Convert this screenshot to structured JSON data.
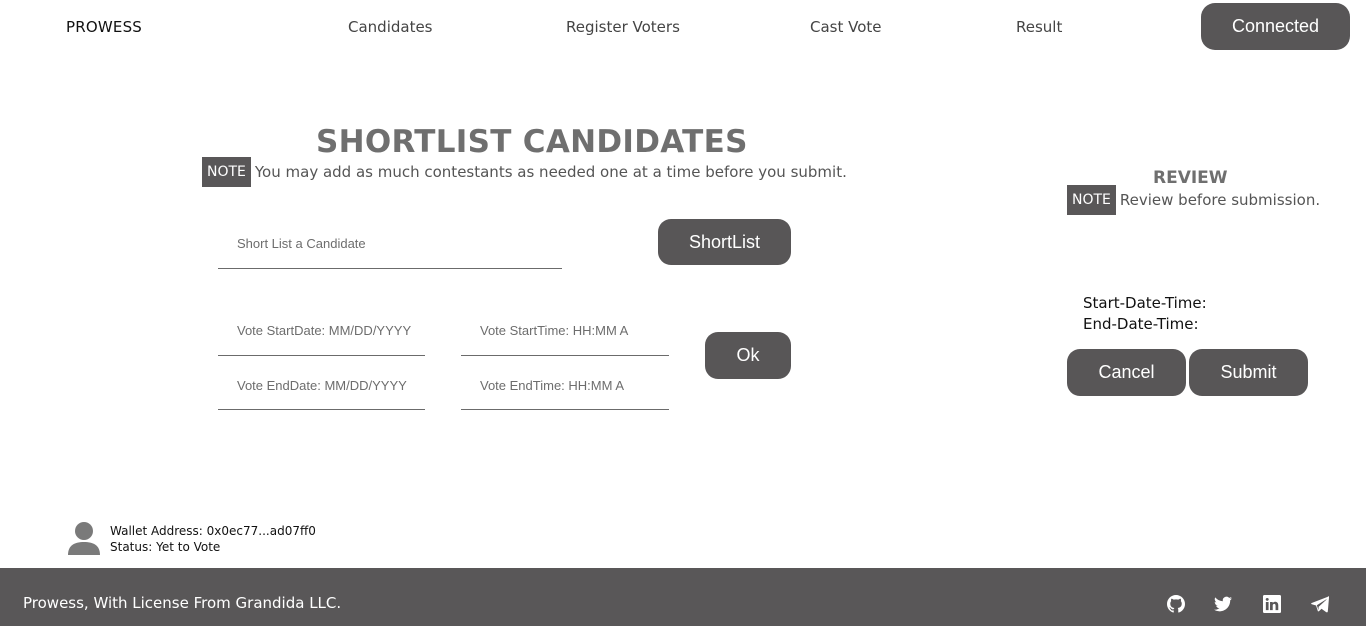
{
  "nav": {
    "brand": "PROWESS",
    "links": [
      "Candidates",
      "Register Voters",
      "Cast Vote",
      "Result"
    ],
    "connect_label": "Connected"
  },
  "shortlist": {
    "title": "SHORTLIST CANDIDATES",
    "note_tag": "NOTE",
    "note_text": "You may add as much contestants as needed one at a time before you submit.",
    "candidate_placeholder": "Short List a Candidate",
    "shortlist_button": "ShortList",
    "start_date_placeholder": "Vote StartDate: MM/DD/YYYY",
    "start_time_placeholder": "Vote StartTime: HH:MM A",
    "end_date_placeholder": "Vote EndDate: MM/DD/YYYY",
    "end_time_placeholder": "Vote EndTime: HH:MM A",
    "ok_button": "Ok"
  },
  "review": {
    "title": "REVIEW",
    "note_tag": "NOTE",
    "note_text": "Review before submission.",
    "start_label": "Start-Date-Time:",
    "end_label": "End-Date-Time:",
    "cancel_button": "Cancel",
    "submit_button": "Submit"
  },
  "wallet": {
    "address_line": "Wallet Address: 0x0ec77...ad07ff0",
    "status_line": "Status: Yet to Vote"
  },
  "footer": {
    "text": "Prowess, With License From Grandida LLC.",
    "social_icons": [
      "github-icon",
      "twitter-icon",
      "linkedin-icon",
      "telegram-icon"
    ]
  },
  "colors": {
    "accent": "#585657",
    "footer_bg": "#595758",
    "title_gray": "#6f6f6f"
  }
}
